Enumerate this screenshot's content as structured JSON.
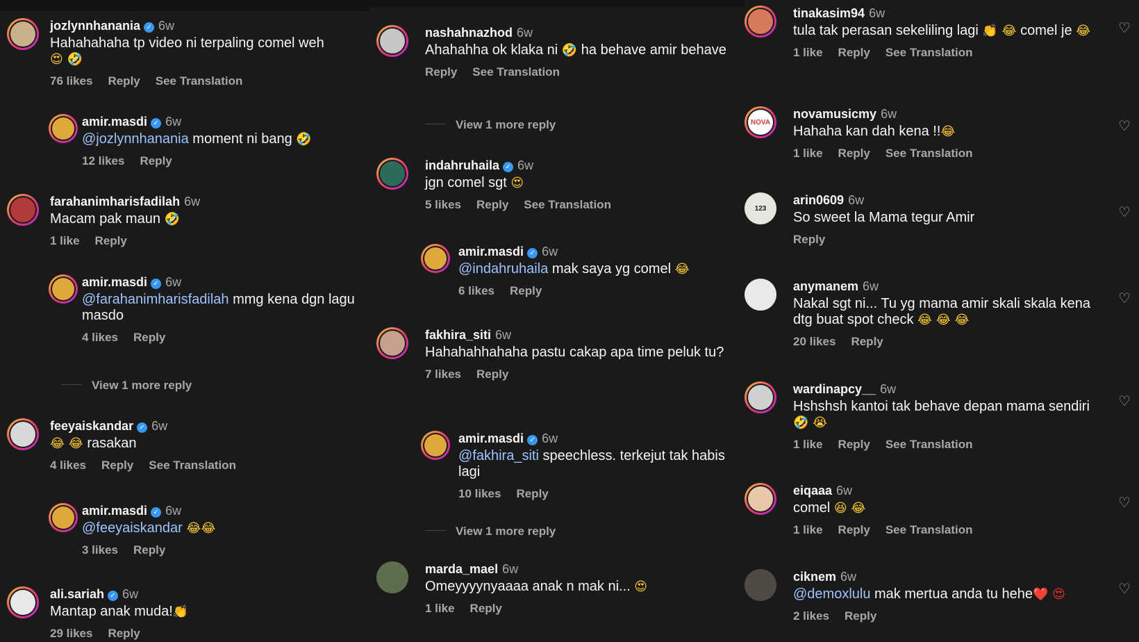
{
  "columns": [
    {
      "comments": [
        {
          "user": "jozlynnhanania",
          "verified": true,
          "time": "6w",
          "text": "Hahahahaha tp video ni terpaling comel weh",
          "emoji": "😍 🤣",
          "likes": "76 likes",
          "reply": "Reply",
          "translation": "See Translation"
        },
        {
          "user": "amir.masdi",
          "verified": true,
          "time": "6w",
          "mention": "@jozlynnhanania",
          "text": " moment ni bang",
          "emoji": "🤣",
          "likes": "12 likes",
          "reply": "Reply"
        },
        {
          "user": "farahanimharisfadilah",
          "verified": false,
          "time": "6w",
          "text": "Macam pak maun",
          "emoji": "🤣",
          "likes": "1 like",
          "reply": "Reply"
        },
        {
          "user": "amir.masdi",
          "verified": true,
          "time": "6w",
          "mention": "@farahanimharisfadilah",
          "text": " mmg kena dgn lagu masdo",
          "likes": "4 likes",
          "reply": "Reply"
        },
        {
          "user": "feeyaiskandar",
          "verified": true,
          "time": "6w",
          "emoji": "😂 😂",
          "text": " rasakan",
          "likes": "4 likes",
          "reply": "Reply",
          "translation": "See Translation"
        },
        {
          "user": "amir.masdi",
          "verified": true,
          "time": "6w",
          "mention": "@feeyaiskandar",
          "emoji": "😂😂",
          "likes": "3 likes",
          "reply": "Reply"
        },
        {
          "user": "ali.sariah",
          "verified": true,
          "time": "6w",
          "text": "Mantap anak muda!",
          "emoji": "👏",
          "likes": "29 likes",
          "reply": "Reply"
        }
      ],
      "view_more": [
        "View 1 more reply"
      ]
    },
    {
      "comments": [
        {
          "user": "nashahnazhod",
          "verified": false,
          "time": "6w",
          "text": "Ahahahha ok klaka ni",
          "emoji": "🤣",
          "text2": " ha behave amir behave",
          "reply": "Reply",
          "translation": "See Translation"
        },
        {
          "user": "indahruhaila",
          "verified": true,
          "time": "6w",
          "text": "jgn comel sgt",
          "emoji": "😍",
          "likes": "5 likes",
          "reply": "Reply",
          "translation": "See Translation"
        },
        {
          "user": "amir.masdi",
          "verified": true,
          "time": "6w",
          "mention": "@indahruhaila",
          "text": " mak saya yg comel",
          "emoji": "😂",
          "likes": "6 likes",
          "reply": "Reply"
        },
        {
          "user": "fakhira_siti",
          "verified": false,
          "time": "6w",
          "text": "Hahahahhahaha pastu cakap apa time peluk tu?",
          "likes": "7 likes",
          "reply": "Reply"
        },
        {
          "user": "amir.masdi",
          "verified": true,
          "time": "6w",
          "mention": "@fakhira_siti",
          "text": " speechless. terkejut tak habis lagi",
          "likes": "10 likes",
          "reply": "Reply"
        },
        {
          "user": "marda_mael",
          "verified": false,
          "time": "6w",
          "text": "Omeyyyynyaaaa anak n mak ni...",
          "emoji": "😍",
          "likes": "1 like",
          "reply": "Reply"
        }
      ],
      "view_more": [
        "View 1 more reply",
        "View 1 more reply"
      ]
    },
    {
      "comments": [
        {
          "user": "tinakasim94",
          "verified": false,
          "time": "6w",
          "text": "tula tak perasan sekeliling lagi",
          "emoji": "👏 😂",
          "text2": " comel je",
          "emoji2": "😂",
          "likes": "1 like",
          "reply": "Reply",
          "translation": "See Translation"
        },
        {
          "user": "novamusicmy",
          "verified": false,
          "time": "6w",
          "text": "Hahaha kan dah kena !!",
          "emoji": "😂",
          "likes": "1 like",
          "reply": "Reply",
          "translation": "See Translation"
        },
        {
          "user": "arin0609",
          "verified": false,
          "time": "6w",
          "text": "So sweet la Mama tegur Amir",
          "reply": "Reply"
        },
        {
          "user": "anymanem",
          "verified": false,
          "time": "6w",
          "text": "Nakal sgt ni... Tu yg mama amir skali skala kena dtg buat spot check",
          "emoji": "😂 😂 😂",
          "likes": "20 likes",
          "reply": "Reply"
        },
        {
          "user": "wardinapcy__",
          "verified": false,
          "time": "6w",
          "text": "Hshshsh kantoi tak behave depan mama sendiri",
          "emoji": "🤣 😭",
          "likes": "1 like",
          "reply": "Reply",
          "translation": "See Translation"
        },
        {
          "user": "eiqaaa",
          "verified": false,
          "time": "6w",
          "text": "comel",
          "emoji": "😆 😂",
          "likes": "1 like",
          "reply": "Reply",
          "translation": "See Translation"
        },
        {
          "user": "ciknem",
          "verified": false,
          "time": "6w",
          "mention": "@demoxlulu",
          "text": " mak mertua anda tu hehe",
          "emoji": "❤️ 😍",
          "likes": "2 likes",
          "reply": "Reply"
        }
      ]
    }
  ],
  "avatar_text": {
    "arin0609": "123",
    "novamusicmy": "NOVA"
  },
  "icons": {
    "like": "heart-icon",
    "verified": "verified-badge-icon"
  },
  "colors": {
    "background": "#1a1a1a",
    "text": "#f5f5f5",
    "muted": "#a8a8a8",
    "mention": "#9ec4ff",
    "verified": "#3897f0"
  }
}
